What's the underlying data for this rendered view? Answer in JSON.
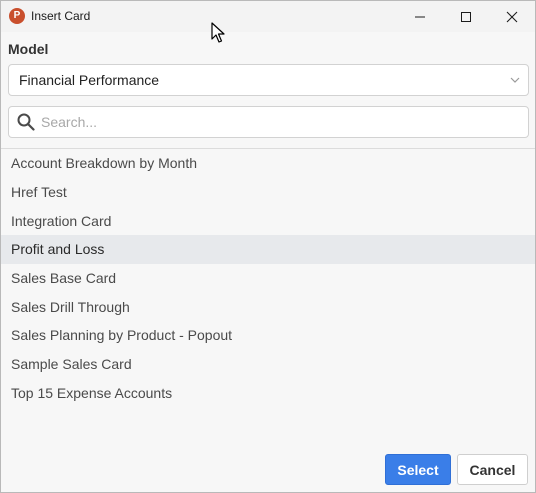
{
  "window": {
    "title": "Insert Card",
    "app_icon_letter": "P"
  },
  "model": {
    "label": "Model",
    "selected": "Financial Performance"
  },
  "search": {
    "placeholder": "Search...",
    "value": ""
  },
  "cards": {
    "items": [
      {
        "label": "Account Breakdown by Month"
      },
      {
        "label": "Href Test"
      },
      {
        "label": "Integration Card"
      },
      {
        "label": "Profit and Loss"
      },
      {
        "label": "Sales Base Card"
      },
      {
        "label": "Sales Drill Through"
      },
      {
        "label": "Sales Planning by Product - Popout"
      },
      {
        "label": "Sample Sales Card"
      },
      {
        "label": "Top 15 Expense Accounts"
      }
    ],
    "selected": "Profit and Loss"
  },
  "footer": {
    "select_label": "Select",
    "cancel_label": "Cancel"
  },
  "colors": {
    "accent": "#3a7ee8",
    "selected_row": "#e7e9ec",
    "app_icon": "#c94f2d"
  }
}
